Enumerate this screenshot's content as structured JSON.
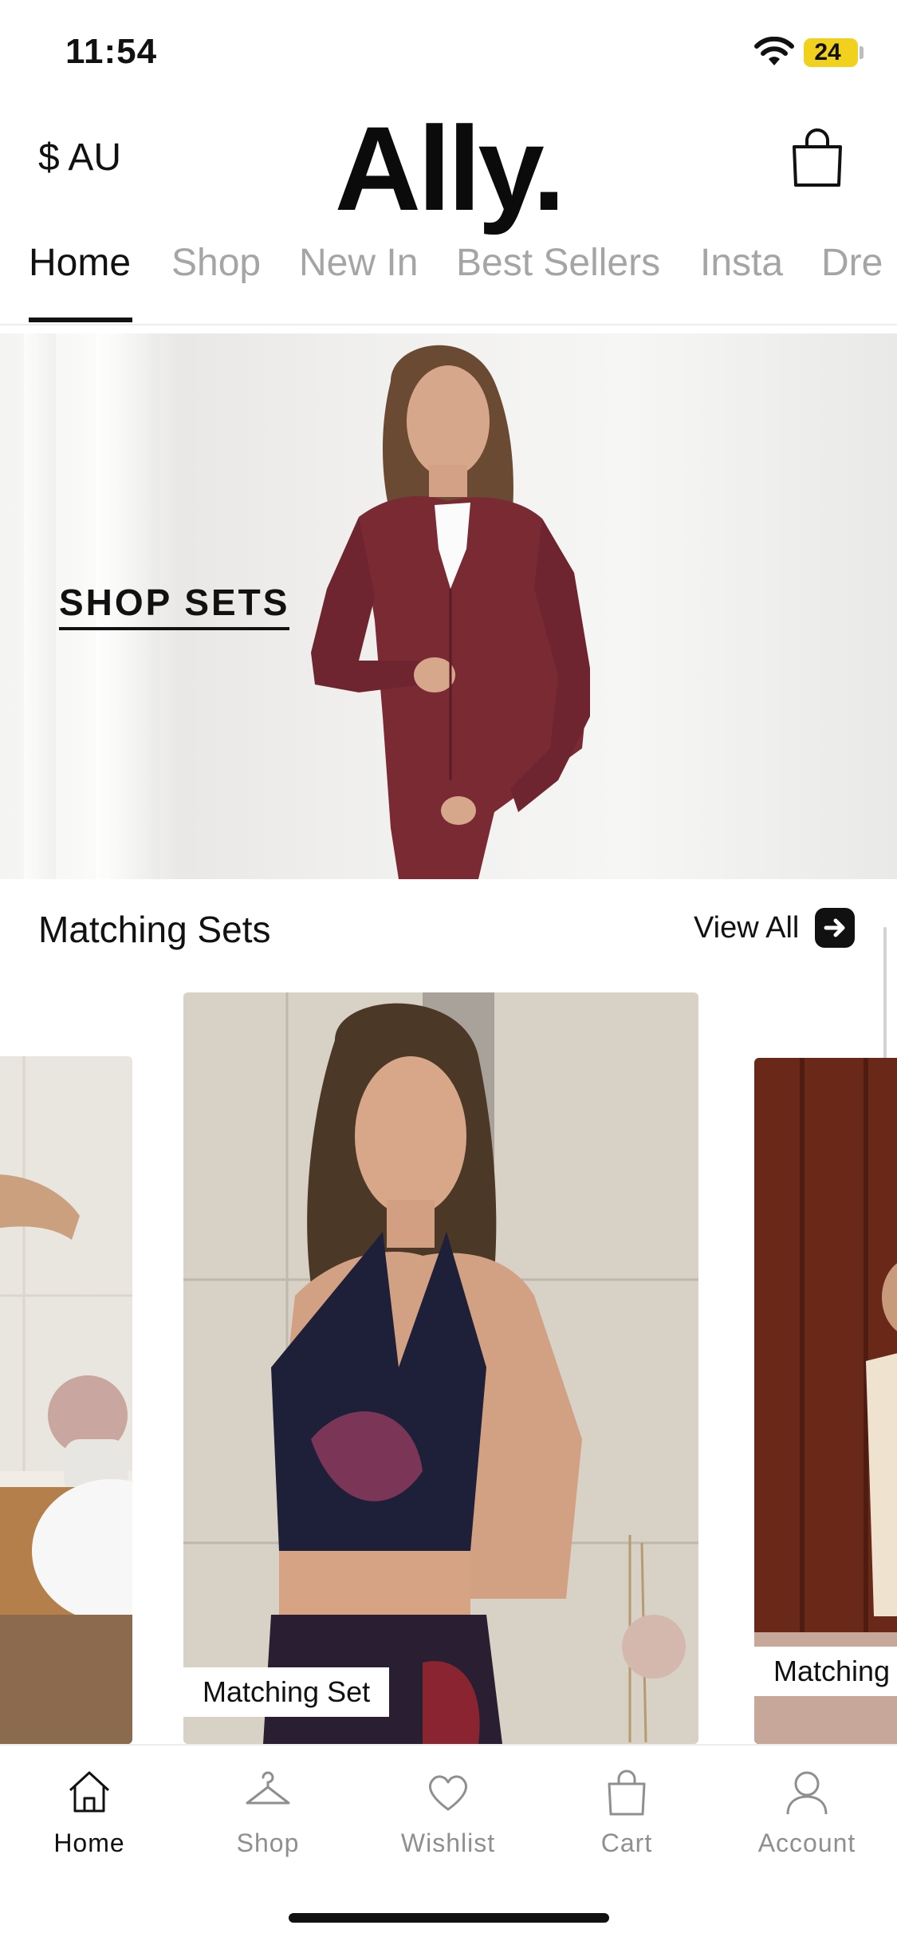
{
  "status_bar": {
    "time": "11:54",
    "battery": "24"
  },
  "header": {
    "currency": "$ AU",
    "logo": "Ally.",
    "cart_icon": "shopping-bag-icon"
  },
  "tabs": [
    {
      "label": "Home",
      "active": true
    },
    {
      "label": "Shop"
    },
    {
      "label": "New In"
    },
    {
      "label": "Best Sellers"
    },
    {
      "label": "Insta"
    },
    {
      "label": "Dre"
    }
  ],
  "hero": {
    "cta": "SHOP SETS",
    "jacket_color": "#7a2a33"
  },
  "section": {
    "title": "Matching Sets",
    "view_all": "View All",
    "view_all_icon": "arrow-right-icon"
  },
  "cards": [
    {
      "label": ""
    },
    {
      "label": "Matching Set"
    },
    {
      "label": "Matching S"
    }
  ],
  "bottom_nav": [
    {
      "label": "Home",
      "icon": "home-icon",
      "active": true
    },
    {
      "label": "Shop",
      "icon": "hanger-icon"
    },
    {
      "label": "Wishlist",
      "icon": "heart-icon"
    },
    {
      "label": "Cart",
      "icon": "shopping-bag-icon"
    },
    {
      "label": "Account",
      "icon": "user-icon"
    }
  ],
  "colors": {
    "accent": "#111111",
    "inactive": "#a5a5a5",
    "battery": "#f2d01e"
  }
}
